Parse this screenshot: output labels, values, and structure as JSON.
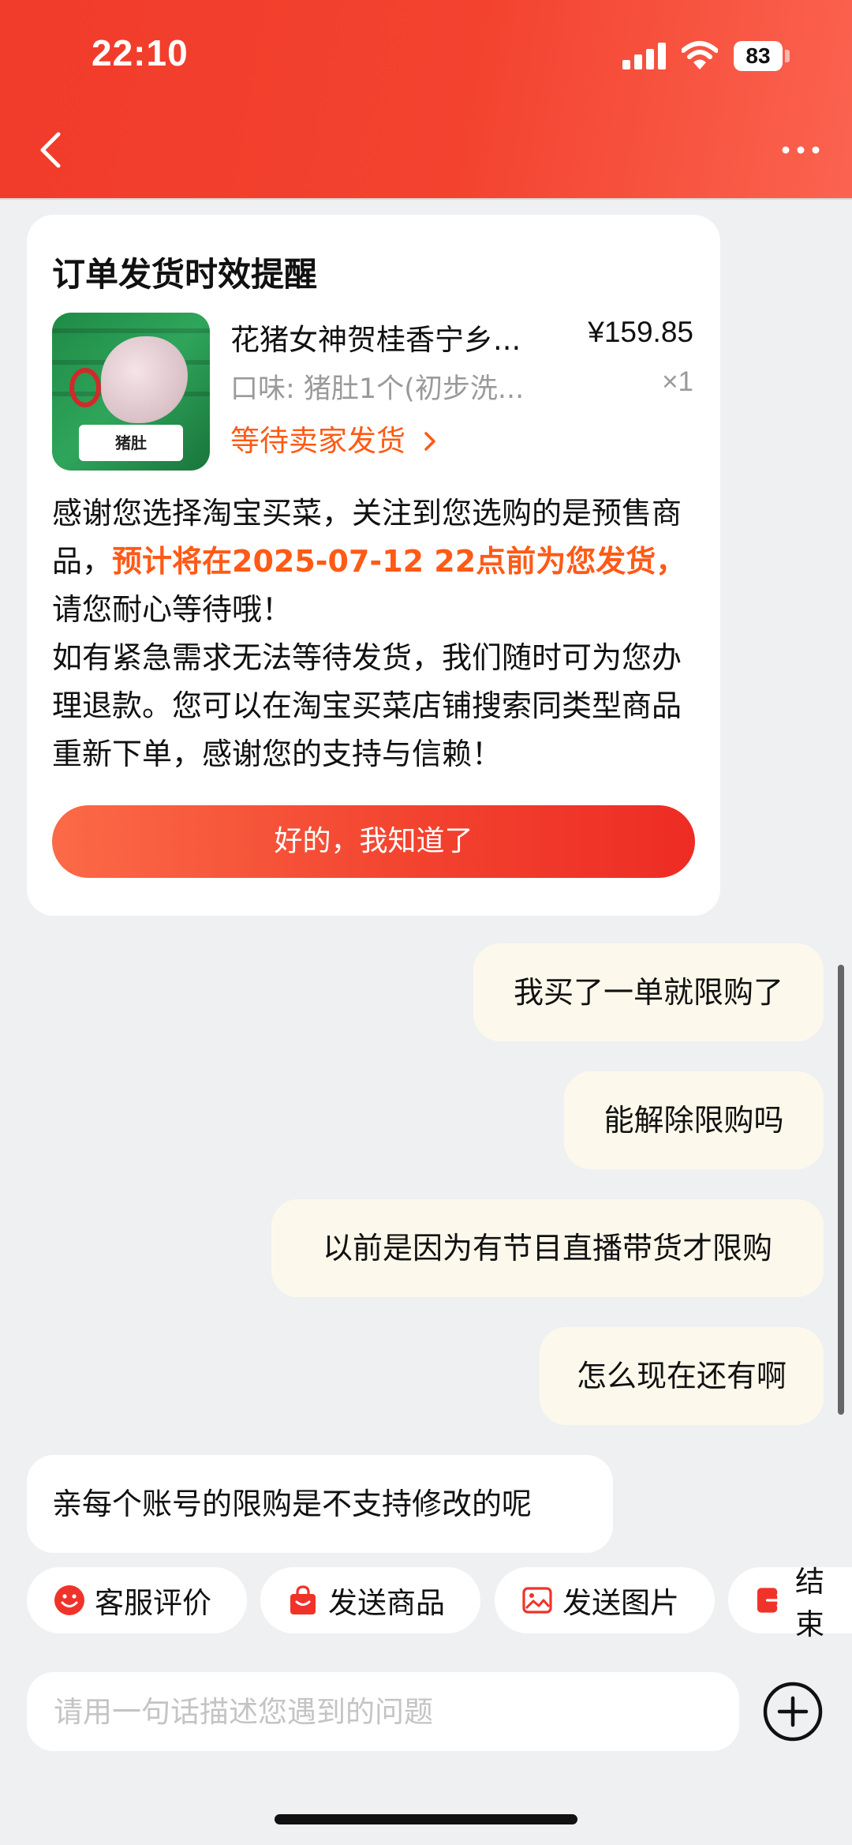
{
  "status_bar": {
    "time": "22:10",
    "battery": "83"
  },
  "order_card": {
    "title": "订单发货时效提醒",
    "product": {
      "image_label": "猪肚",
      "name": "花猪女神贺桂香宁乡...",
      "price": "¥159.85",
      "spec": "口味: 猪肚1个(初步洗...",
      "qty": "×1",
      "status": "等待卖家发货"
    },
    "message": {
      "part1": "感谢您选择淘宝买菜，关注到您选购的是预售商品，",
      "highlight": "预计将在2025-07-12 22点前为您发货，",
      "part2": "请您耐心等待哦！",
      "part3": "如有紧急需求无法等待发货，我们随时可为您办理退款。您可以在淘宝买菜店铺搜索同类型商品重新下单，感谢您的支持与信赖！"
    },
    "ack_button": "好的，我知道了"
  },
  "chat": {
    "messages": [
      {
        "from": "me",
        "text": "我买了一单就限购了"
      },
      {
        "from": "me",
        "text": "能解除限购吗"
      },
      {
        "from": "me",
        "text": "以前是因为有节目直播带货才限购"
      },
      {
        "from": "me",
        "text": "怎么现在还有啊"
      },
      {
        "from": "agent",
        "text": "亲每个账号的限购是不支持修改的呢"
      }
    ]
  },
  "quick_actions": [
    {
      "label": "客服评价",
      "icon": "smiley-icon"
    },
    {
      "label": "发送商品",
      "icon": "shopping-bag-icon"
    },
    {
      "label": "发送图片",
      "icon": "image-icon"
    },
    {
      "label": "结束",
      "icon": "exit-icon"
    }
  ],
  "input": {
    "placeholder": "请用一句话描述您遇到的问题"
  },
  "colors": {
    "brand": "#f3432f",
    "highlight": "#ff5a16",
    "my_bubble": "#fcf9ec"
  }
}
